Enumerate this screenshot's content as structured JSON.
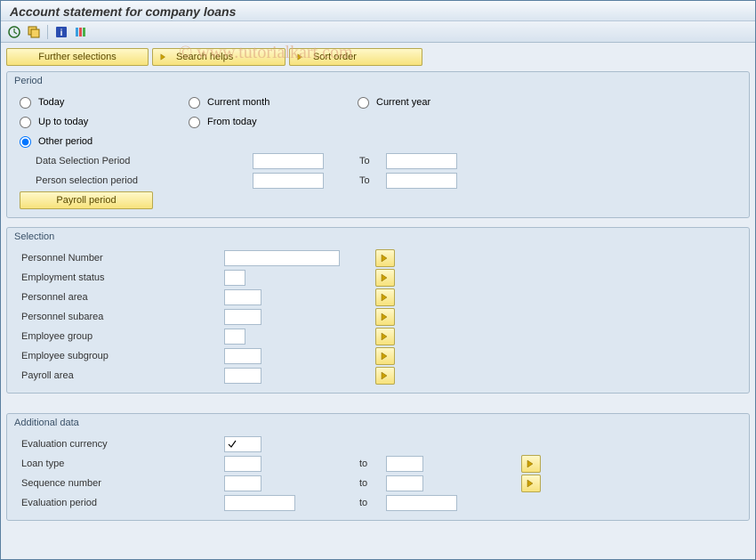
{
  "window": {
    "title": "Account statement for company loans"
  },
  "watermark": "© www.tutorialkart.com",
  "action_buttons": {
    "further": "Further selections",
    "search": "Search helps",
    "sort": "Sort order"
  },
  "period": {
    "legend": "Period",
    "today": "Today",
    "current_month": "Current month",
    "current_year": "Current year",
    "up_to_today": "Up to today",
    "from_today": "From today",
    "other_period": "Other period",
    "data_sel": "Data Selection Period",
    "data_from": "",
    "to1": "To",
    "data_to": "",
    "pers_sel": "Person selection period",
    "pers_from": "",
    "to2": "To",
    "pers_to": "",
    "payroll_btn": "Payroll period"
  },
  "selection": {
    "legend": "Selection",
    "rows": [
      {
        "label": "Personnel Number",
        "w": "med",
        "val": ""
      },
      {
        "label": "Employment status",
        "w": "sm",
        "val": ""
      },
      {
        "label": "Personnel area",
        "w": "sm2",
        "val": ""
      },
      {
        "label": "Personnel subarea",
        "w": "sm2",
        "val": ""
      },
      {
        "label": "Employee group",
        "w": "sm",
        "val": ""
      },
      {
        "label": "Employee subgroup",
        "w": "sm2",
        "val": ""
      },
      {
        "label": "Payroll area",
        "w": "sm2",
        "val": ""
      }
    ]
  },
  "additional": {
    "legend": "Additional data",
    "eval_currency": "Evaluation currency",
    "eval_currency_val": "",
    "loan_type": "Loan type",
    "loan_type_from": "",
    "loan_type_to_lbl": "to",
    "loan_type_to": "",
    "sequence": "Sequence number",
    "sequence_from": "",
    "sequence_to_lbl": "to",
    "sequence_to": "",
    "eval_period": "Evaluation period",
    "eval_period_from": "",
    "eval_period_to_lbl": "to",
    "eval_period_to": ""
  }
}
